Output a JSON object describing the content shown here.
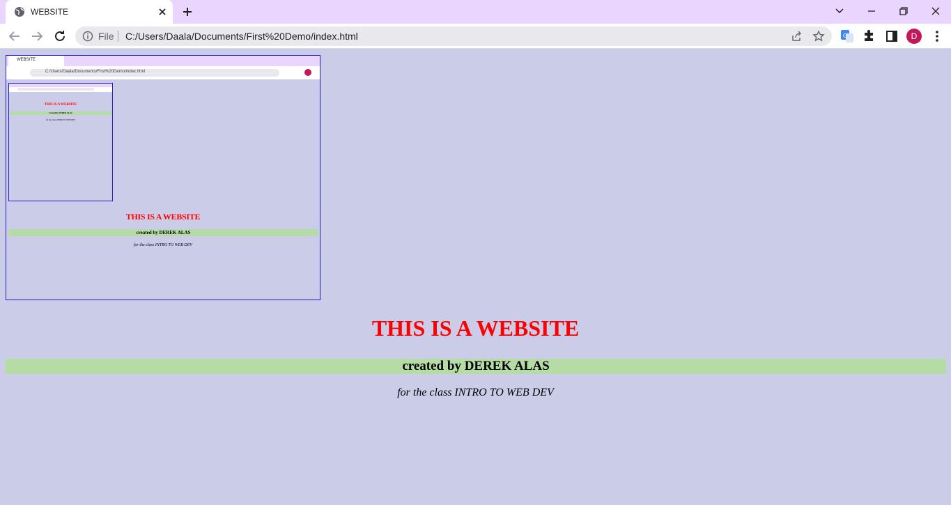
{
  "browser": {
    "tab_title": "WEBSITE",
    "scheme_label": "File",
    "url": "C:/Users/Daala/Documents/First%20Demo/index.html",
    "profile_initial": "D",
    "accent_color": "#e9d5fd",
    "avatar_color": "#c2185b"
  },
  "page": {
    "title": "THIS IS A WEBSITE",
    "credit": "created by DEREK ALAS",
    "subtitle": "for the class INTRO TO WEB DEV",
    "background_color": "#cbcde8",
    "title_color": "#ff0000",
    "credit_bar_color": "#b5dca5"
  }
}
